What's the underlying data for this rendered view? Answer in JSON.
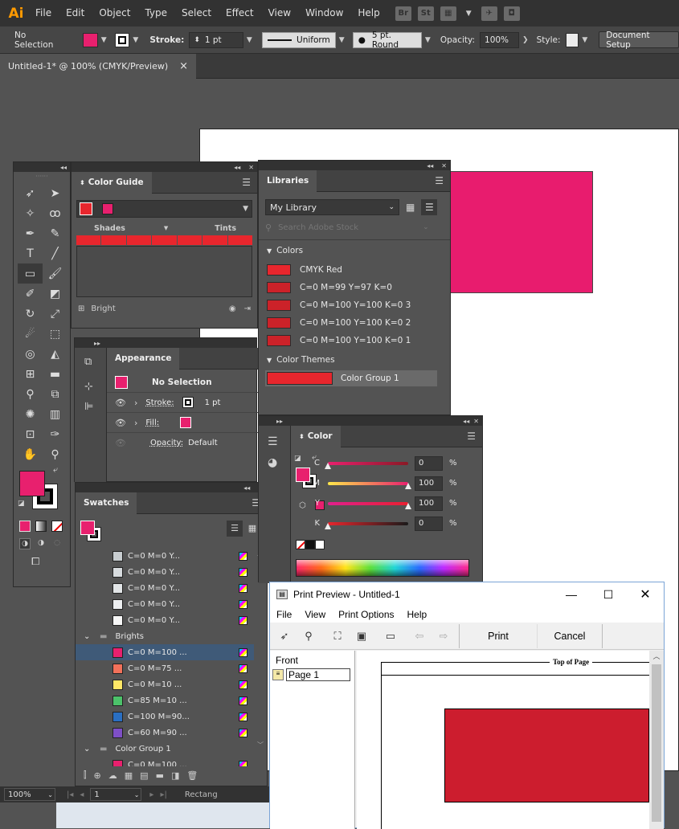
{
  "app": {
    "logo": "Ai"
  },
  "menu": [
    "File",
    "Edit",
    "Object",
    "Type",
    "Select",
    "Effect",
    "View",
    "Window",
    "Help"
  ],
  "menubar_icons": [
    "Br",
    "St"
  ],
  "control": {
    "selection": "No Selection",
    "stroke_label": "Stroke:",
    "stroke_value": "1 pt",
    "profile": "Uniform",
    "brush": "5 pt. Round",
    "opacity_label": "Opacity:",
    "opacity_value": "100%",
    "style_label": "Style:",
    "doc_setup": "Document Setup",
    "fill_color": "#e8206e"
  },
  "doc_tab": {
    "title": "Untitled-1* @ 100% (CMYK/Preview)",
    "close": "×"
  },
  "color_guide": {
    "tab": "Color Guide",
    "shades": "Shades",
    "tints": "Tints",
    "footer": "Bright",
    "base_color": "#e8262d"
  },
  "libraries": {
    "tab": "Libraries",
    "library": "My Library",
    "search_placeholder": "Search Adobe Stock",
    "colors_heading": "Colors",
    "colors": [
      "CMYK Red",
      "C=0 M=99 Y=97 K=0",
      "C=0 M=100 Y=100 K=0 3",
      "C=0 M=100 Y=100 K=0 2",
      "C=0 M=100 Y=100 K=0 1"
    ],
    "themes_heading": "Color Themes",
    "theme": "Color Group 1"
  },
  "appearance": {
    "tab": "Appearance",
    "title": "No Selection",
    "stroke_label": "Stroke:",
    "stroke_value": "1 pt",
    "fill_label": "Fill:",
    "opacity_label": "Opacity:",
    "opacity_value": "Default"
  },
  "swatches": {
    "tab": "Swatches",
    "rows_top": [
      "C=0 M=0 Y...",
      "C=0 M=0 Y...",
      "C=0 M=0 Y...",
      "C=0 M=0 Y...",
      "C=0 M=0 Y..."
    ],
    "top_colors": [
      "#c8cdd0",
      "#d8dcdf",
      "#e2e5e7",
      "#eceef0",
      "#f7f7f7"
    ],
    "group1": "Brights",
    "brights": [
      {
        "label": "C=0 M=100 ...",
        "color": "#e8206e"
      },
      {
        "label": "C=0 M=75 ...",
        "color": "#f2715a"
      },
      {
        "label": "C=0 M=10 ...",
        "color": "#ffe766"
      },
      {
        "label": "C=85 M=10 ...",
        "color": "#4cc26a"
      },
      {
        "label": "C=100 M=90...",
        "color": "#2a6fc2"
      },
      {
        "label": "C=60 M=90 ...",
        "color": "#7e4fc6"
      }
    ],
    "group2": "Color Group 1",
    "group2_rows": [
      {
        "label": "C=0 M=100 ...",
        "color": "#e8206e"
      }
    ]
  },
  "color_panel": {
    "tab": "Color",
    "channels": [
      {
        "label": "C",
        "value": "0"
      },
      {
        "label": "M",
        "value": "100"
      },
      {
        "label": "Y",
        "value": "100"
      },
      {
        "label": "K",
        "value": "0"
      }
    ],
    "pct": "%"
  },
  "status": {
    "zoom": "100%",
    "page": "1",
    "tool": "Rectang"
  },
  "print_preview": {
    "title": "Print Preview - Untitled-1",
    "menu": [
      "File",
      "View",
      "Print Options",
      "Help"
    ],
    "print": "Print",
    "cancel": "Cancel",
    "tree_root": "Front",
    "tree_page": "Page 1",
    "top_of_page": "Top of Page",
    "rect_color": "#cc1d2e"
  },
  "canvas_rect_color": "#e81c6e"
}
